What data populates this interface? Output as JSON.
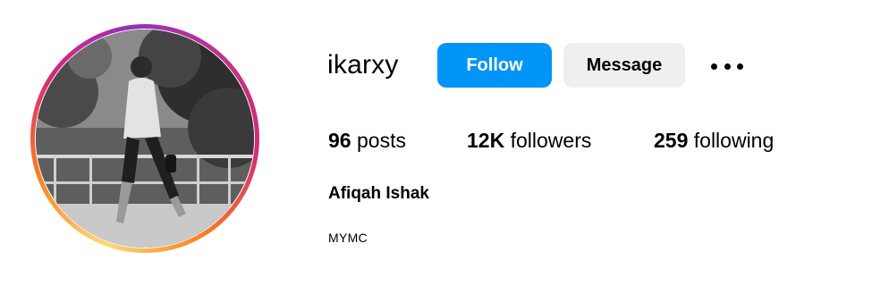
{
  "profile": {
    "username": "ikarxy",
    "full_name": "Afiqah Ishak",
    "bio": "MYMC",
    "avatar_icon": "profile-photo"
  },
  "actions": {
    "follow_label": "Follow",
    "message_label": "Message",
    "more_icon": "more-options-icon"
  },
  "stats": {
    "posts_count": "96",
    "posts_label": "posts",
    "followers_count": "12K",
    "followers_label": "followers",
    "following_count": "259",
    "following_label": "following"
  },
  "colors": {
    "accent": "#0095f6",
    "secondary_button": "#efefef",
    "ring_gradient": [
      "#feda75",
      "#fa7e1e",
      "#d62976",
      "#962fbf"
    ]
  }
}
